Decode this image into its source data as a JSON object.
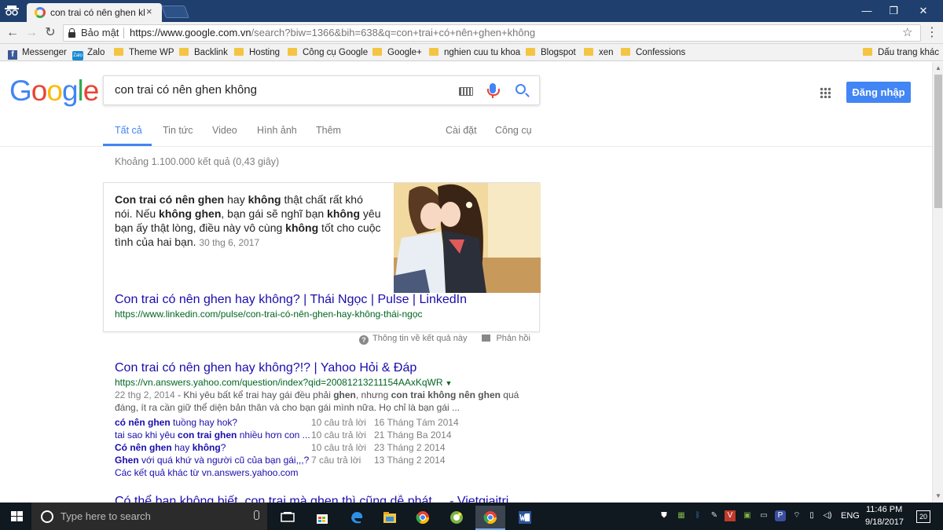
{
  "browser": {
    "tab_title": "con trai có nên ghen khô",
    "tab_close": "×",
    "window": {
      "minimize": "—",
      "restore": "❐",
      "close": "✕"
    },
    "secure_label": "Bảo mật",
    "url_host": "https://www.google.com.vn",
    "url_path": "/search?biw=1366&bih=638&q=con+trai+có+nên+ghen+không",
    "bookmarks": [
      {
        "label": "Messenger",
        "icon": "facebook-icon"
      },
      {
        "label": "Zalo",
        "icon": "zalo-icon"
      },
      {
        "label": "Theme WP",
        "icon": "folder-icon"
      },
      {
        "label": "Backlink",
        "icon": "folder-icon"
      },
      {
        "label": "Hosting",
        "icon": "folder-icon"
      },
      {
        "label": "Công cụ Google",
        "icon": "folder-icon"
      },
      {
        "label": "Google+",
        "icon": "folder-icon"
      },
      {
        "label": "nghien cuu tu khoa",
        "icon": "folder-icon"
      },
      {
        "label": "Blogspot",
        "icon": "folder-icon"
      },
      {
        "label": "xen",
        "icon": "folder-icon"
      },
      {
        "label": "Confessions",
        "icon": "folder-icon"
      }
    ],
    "other_bookmarks": "Dấu trang khác"
  },
  "google": {
    "logo": [
      "G",
      "o",
      "o",
      "g",
      "l",
      "e"
    ],
    "query": "con trai có nên ghen không",
    "signin_label": "Đăng nhập",
    "tabs": [
      "Tất cả",
      "Tin tức",
      "Video",
      "Hình ảnh",
      "Thêm"
    ],
    "settings_label": "Cài đặt",
    "tools_label": "Công cụ",
    "result_stats": "Khoảng 1.100.000 kết quả (0,43 giây)",
    "colors": {
      "link": "#1a0dab",
      "url": "#006621",
      "accent": "#4285f4"
    }
  },
  "featured": {
    "snippet_parts": [
      {
        "b": true,
        "t": "Con trai có nên ghen"
      },
      {
        "b": false,
        "t": " hay "
      },
      {
        "b": true,
        "t": "không"
      },
      {
        "b": false,
        "t": " thật chất rất khó nói. Nếu "
      },
      {
        "b": true,
        "t": "không ghen"
      },
      {
        "b": false,
        "t": ", bạn gái sẽ nghĩ bạn "
      },
      {
        "b": true,
        "t": "không"
      },
      {
        "b": false,
        "t": " yêu bạn ấy thật lòng, điều này vô cùng "
      },
      {
        "b": true,
        "t": "không"
      },
      {
        "b": false,
        "t": " tốt cho cuộc tình của hai bạn."
      }
    ],
    "date": "30 thg 6, 2017",
    "title": "Con trai có nên ghen hay không? | Thái Ngọc | Pulse | LinkedIn",
    "url": "https://www.linkedin.com/pulse/con-trai-có-nên-ghen-hay-không-thái-ngọc",
    "about_label": "Thông tin về kết quả này",
    "feedback_label": "Phản hồi"
  },
  "result1": {
    "title": "Con trai có nên ghen hay không?!? | Yahoo Hỏi & Đáp",
    "url": "https://vn.answers.yahoo.com/question/index?qid=20081213211154AAxKqWR",
    "caret": "▼",
    "date": "22 thg 2, 2014",
    "snippet_parts": [
      {
        "b": false,
        "t": " - Khi yêu bất kể trai hay gái đều phải "
      },
      {
        "b": true,
        "t": "ghen"
      },
      {
        "b": false,
        "t": ", nhưng "
      },
      {
        "b": true,
        "t": "con trai không nên ghen"
      },
      {
        "b": false,
        "t": " quá đáng, ít ra cần giữ thể diện bản thân và cho bạn gái mình nữa. Họ chỉ là bạn gái ..."
      }
    ],
    "related": [
      {
        "parts": [
          {
            "b": true,
            "t": "có nên ghen"
          },
          {
            "b": false,
            "t": " tuồng hay hok?"
          }
        ],
        "answers": "10 câu trả lời",
        "date": "16 Tháng Tám 2014"
      },
      {
        "parts": [
          {
            "b": false,
            "t": "tai sao khi yêu "
          },
          {
            "b": true,
            "t": "con trai ghen"
          },
          {
            "b": false,
            "t": " nhiều hơn con ..."
          }
        ],
        "answers": "10 câu trả lời",
        "date": "21 Tháng Ba 2014"
      },
      {
        "parts": [
          {
            "b": true,
            "t": "Có nên ghen"
          },
          {
            "b": false,
            "t": " hay "
          },
          {
            "b": true,
            "t": "không"
          },
          {
            "b": false,
            "t": "?"
          }
        ],
        "answers": "10 câu trả lời",
        "date": "23 Tháng 2 2014"
      },
      {
        "parts": [
          {
            "b": true,
            "t": "Ghen"
          },
          {
            "b": false,
            "t": " với quá khứ và người cũ của bạn gái,,,?"
          }
        ],
        "answers": "7 câu trả lời",
        "date": "13 Tháng 2 2014"
      }
    ],
    "more": "Các kết quả khác từ vn.answers.yahoo.com"
  },
  "result2": {
    "title": "Có thể bạn không biết, con trai mà ghen thì cũng dễ phát ... - Vietgiaitri"
  },
  "taskbar": {
    "search_placeholder": "Type here to search",
    "lang": "ENG",
    "time": "11:46 PM",
    "date": "9/18/2017",
    "notifications": "20"
  }
}
